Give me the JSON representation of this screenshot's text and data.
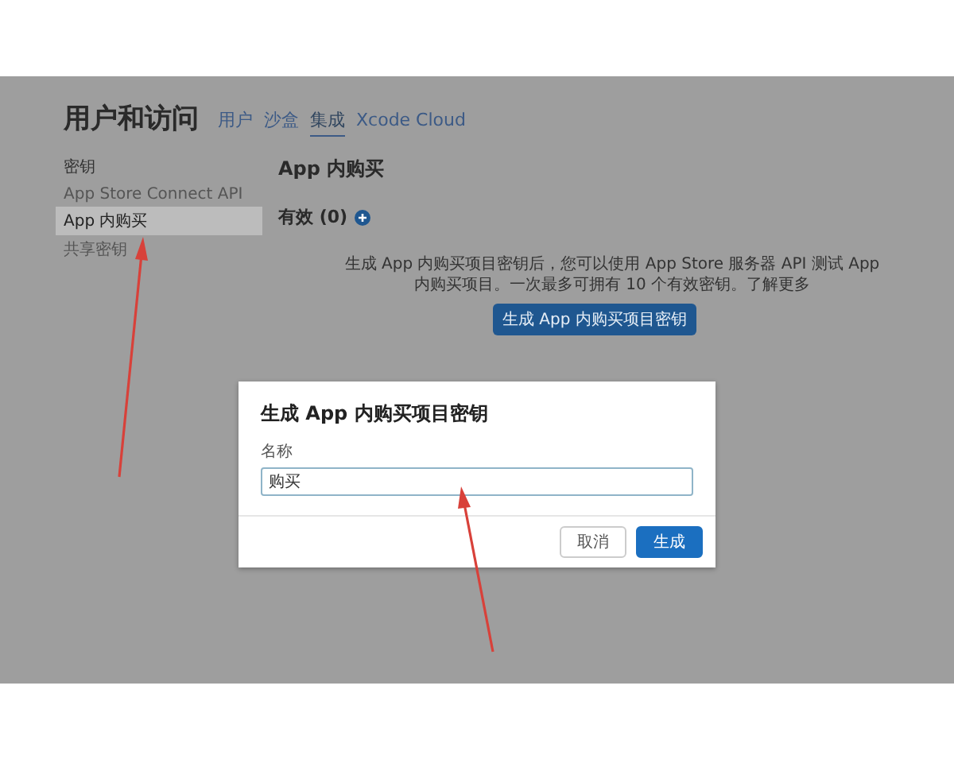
{
  "page_title": "用户和访问",
  "tabs": [
    {
      "label": "用户",
      "selected": false
    },
    {
      "label": "沙盒",
      "selected": false
    },
    {
      "label": "集成",
      "selected": true
    },
    {
      "label": "Xcode Cloud",
      "selected": false
    }
  ],
  "sidebar": {
    "heading": "密钥",
    "items": [
      {
        "label": "App Store Connect API",
        "selected": false
      },
      {
        "label": "App 内购买",
        "selected": true
      },
      {
        "label": "共享密钥",
        "selected": false
      }
    ]
  },
  "content": {
    "title": "App 内购买",
    "section": "有效 (0)",
    "description": "生成 App 内购买项目密钥后，您可以使用 App Store 服务器 API 测试 App 内购买项目。一次最多可拥有 10 个有效密钥。了解更多",
    "generate_button": "生成 App 内购买项目密钥"
  },
  "dialog": {
    "title": "生成 App 内购买项目密钥",
    "field_label": "名称",
    "field_value": "购买",
    "buttons": [
      {
        "label": "取消",
        "kind": "secondary"
      },
      {
        "label": "生成",
        "kind": "primary"
      }
    ]
  }
}
